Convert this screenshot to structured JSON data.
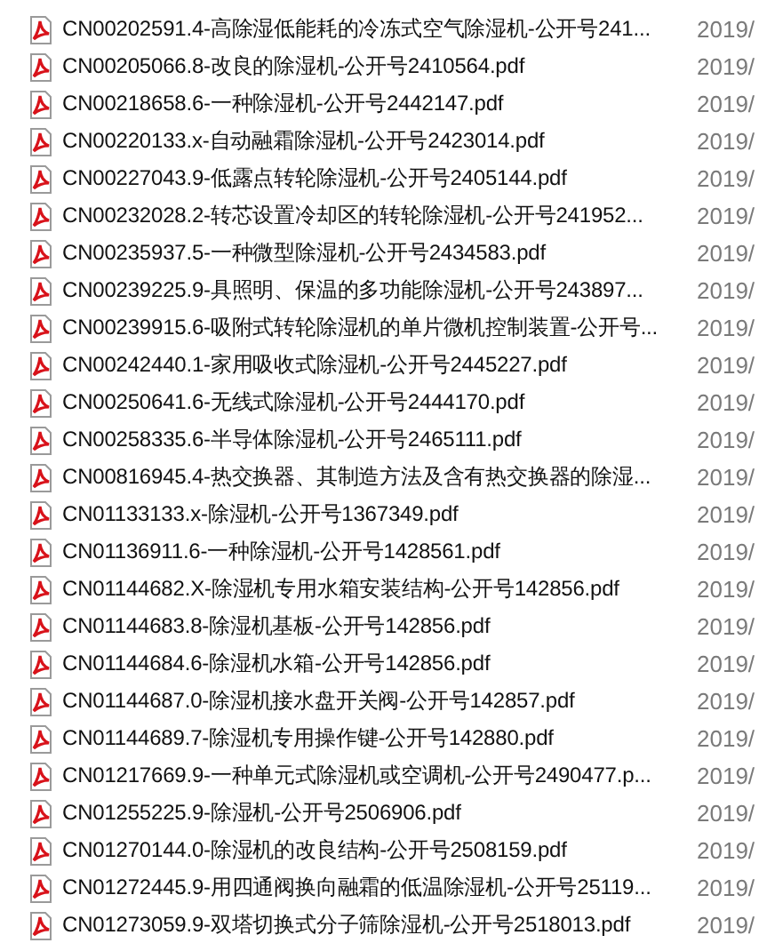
{
  "files": [
    {
      "name": "CN00202591.4-高除湿低能耗的冷冻式空气除湿机-公开号241...",
      "date": "2019/"
    },
    {
      "name": "CN00205066.8-改良的除湿机-公开号2410564.pdf",
      "date": "2019/"
    },
    {
      "name": "CN00218658.6-一种除湿机-公开号2442147.pdf",
      "date": "2019/"
    },
    {
      "name": "CN00220133.x-自动融霜除湿机-公开号2423014.pdf",
      "date": "2019/"
    },
    {
      "name": "CN00227043.9-低露点转轮除湿机-公开号2405144.pdf",
      "date": "2019/"
    },
    {
      "name": "CN00232028.2-转芯设置冷却区的转轮除湿机-公开号241952...",
      "date": "2019/"
    },
    {
      "name": "CN00235937.5-一种微型除湿机-公开号2434583.pdf",
      "date": "2019/"
    },
    {
      "name": "CN00239225.9-具照明、保温的多功能除湿机-公开号243897...",
      "date": "2019/"
    },
    {
      "name": "CN00239915.6-吸附式转轮除湿机的单片微机控制装置-公开号...",
      "date": "2019/"
    },
    {
      "name": "CN00242440.1-家用吸收式除湿机-公开号2445227.pdf",
      "date": "2019/"
    },
    {
      "name": "CN00250641.6-无线式除湿机-公开号2444170.pdf",
      "date": "2019/"
    },
    {
      "name": "CN00258335.6-半导体除湿机-公开号2465111.pdf",
      "date": "2019/"
    },
    {
      "name": "CN00816945.4-热交换器、其制造方法及含有热交换器的除湿...",
      "date": "2019/"
    },
    {
      "name": "CN01133133.x-除湿机-公开号1367349.pdf",
      "date": "2019/"
    },
    {
      "name": "CN01136911.6-一种除湿机-公开号1428561.pdf",
      "date": "2019/"
    },
    {
      "name": "CN01144682.X-除湿机专用水箱安装结构-公开号142856.pdf",
      "date": "2019/"
    },
    {
      "name": "CN01144683.8-除湿机基板-公开号142856.pdf",
      "date": "2019/"
    },
    {
      "name": "CN01144684.6-除湿机水箱-公开号142856.pdf",
      "date": "2019/"
    },
    {
      "name": "CN01144687.0-除湿机接水盘开关阀-公开号142857.pdf",
      "date": "2019/"
    },
    {
      "name": "CN01144689.7-除湿机专用操作键-公开号142880.pdf",
      "date": "2019/"
    },
    {
      "name": "CN01217669.9-一种单元式除湿机或空调机-公开号2490477.p...",
      "date": "2019/"
    },
    {
      "name": "CN01255225.9-除湿机-公开号2506906.pdf",
      "date": "2019/"
    },
    {
      "name": "CN01270144.0-除湿机的改良结构-公开号2508159.pdf",
      "date": "2019/"
    },
    {
      "name": "CN01272445.9-用四通阀换向融霜的低温除湿机-公开号25119...",
      "date": "2019/"
    },
    {
      "name": "CN01273059.9-双塔切换式分子筛除湿机-公开号2518013.pdf",
      "date": "2019/"
    }
  ]
}
